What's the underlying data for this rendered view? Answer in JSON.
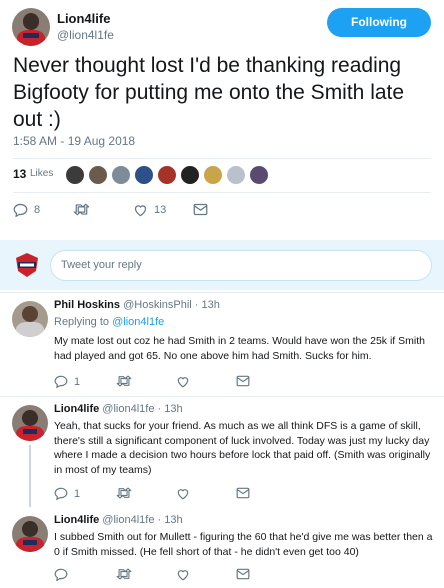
{
  "main_tweet": {
    "author_name": "Lion4life",
    "author_handle": "@lion4l1fe",
    "follow_label": "Following",
    "text": "Never thought lost I'd be thanking reading Bigfooty for putting me onto the Smith late out :)",
    "timestamp": "1:58 AM - 19 Aug 2018",
    "likes_count": "13",
    "likes_label": "Likes",
    "reply_count": "8",
    "retweet_count": "",
    "like_count": "13"
  },
  "reply_box": {
    "placeholder": "Tweet your reply"
  },
  "replies": [
    {
      "author_name": "Phil Hoskins",
      "author_handle": "@HoskinsPhil",
      "time": "13h",
      "replying_prefix": "Replying to",
      "replying_to": "@lion4l1fe",
      "text": "My mate lost out coz he had Smith in 2 teams. Would have won the 25k if Smith had played and got 65. No one above him had Smith. Sucks for him.",
      "reply_count": "1",
      "retweet_count": "",
      "like_count": ""
    },
    {
      "author_name": "Lion4life",
      "author_handle": "@lion4l1fe",
      "time": "13h",
      "text": "Yeah, that sucks for your friend. As much as we all think DFS is a game of skill, there's still a significant component of luck involved. Today was just my lucky day where I made a decision two hours before lock that paid off. (Smith was originally in most of my teams)",
      "reply_count": "1",
      "retweet_count": "",
      "like_count": ""
    },
    {
      "author_name": "Lion4life",
      "author_handle": "@lion4l1fe",
      "time": "13h",
      "text": "I subbed Smith out for Mullett - figuring the 60 that he'd give me was better then a 0 if Smith missed. (He fell short of that - he didn't even get too 40)",
      "reply_count": "",
      "retweet_count": "",
      "like_count": ""
    }
  ],
  "colors": {
    "accent": "#1da1f2",
    "text": "#14171a",
    "muted": "#657786",
    "reply_bg": "#e8f5fd"
  },
  "icons": {
    "reply": "reply-icon",
    "retweet": "retweet-icon",
    "like": "heart-icon",
    "dm": "envelope-icon"
  }
}
